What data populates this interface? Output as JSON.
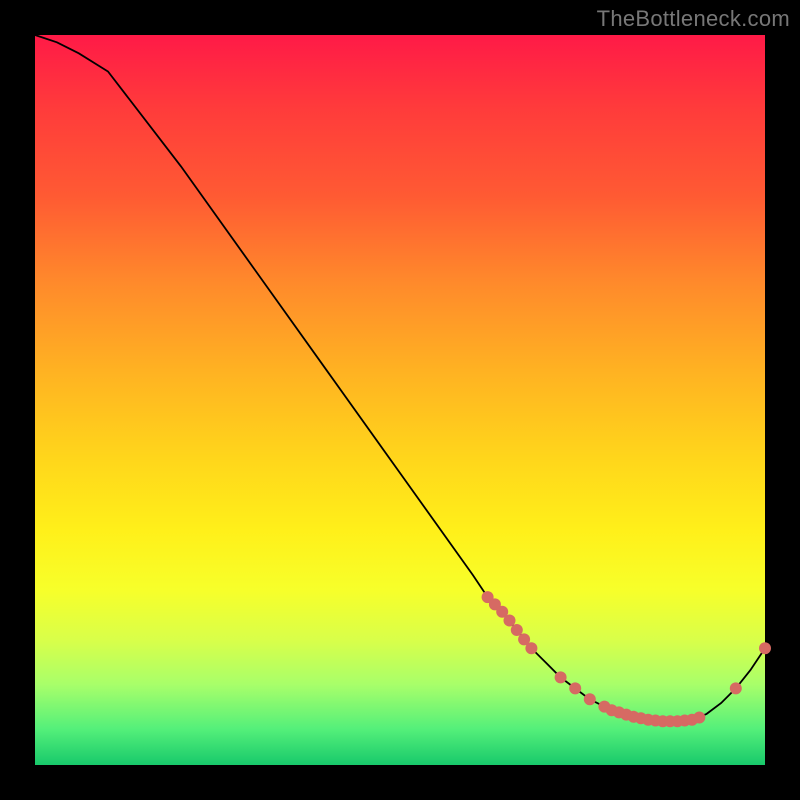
{
  "watermark": "TheBottleneck.com",
  "colors": {
    "background": "#000000",
    "gradient_top": "#ff1a47",
    "gradient_bottom": "#18c96b",
    "line": "#000000",
    "marker": "#d66a63"
  },
  "chart_data": {
    "type": "line",
    "title": "",
    "xlabel": "",
    "ylabel": "",
    "xlim": [
      0,
      100
    ],
    "ylim": [
      0,
      100
    ],
    "x": [
      0,
      3,
      6,
      10,
      20,
      30,
      40,
      50,
      60,
      62,
      64,
      66,
      68,
      70,
      72,
      74,
      76,
      78,
      80,
      82,
      84,
      86,
      88,
      90,
      92,
      94,
      96,
      98,
      100
    ],
    "values": [
      100,
      99,
      97.5,
      95,
      82,
      68,
      54,
      40,
      26,
      23,
      21,
      18.5,
      16,
      14,
      12,
      10.5,
      9,
      8,
      7.2,
      6.6,
      6.2,
      6.0,
      6.0,
      6.2,
      7.0,
      8.5,
      10.5,
      13,
      16
    ],
    "markers_x": [
      62,
      63,
      64,
      65,
      66,
      67,
      68,
      72,
      74,
      76,
      78,
      79,
      80,
      81,
      82,
      83,
      84,
      85,
      86,
      87,
      88,
      89,
      90,
      91,
      96,
      100
    ],
    "markers_y": [
      23,
      22,
      21,
      19.8,
      18.5,
      17.2,
      16,
      12,
      10.5,
      9,
      8,
      7.5,
      7.2,
      6.9,
      6.6,
      6.4,
      6.2,
      6.1,
      6.0,
      6.0,
      6.0,
      6.1,
      6.2,
      6.5,
      10.5,
      16
    ]
  }
}
